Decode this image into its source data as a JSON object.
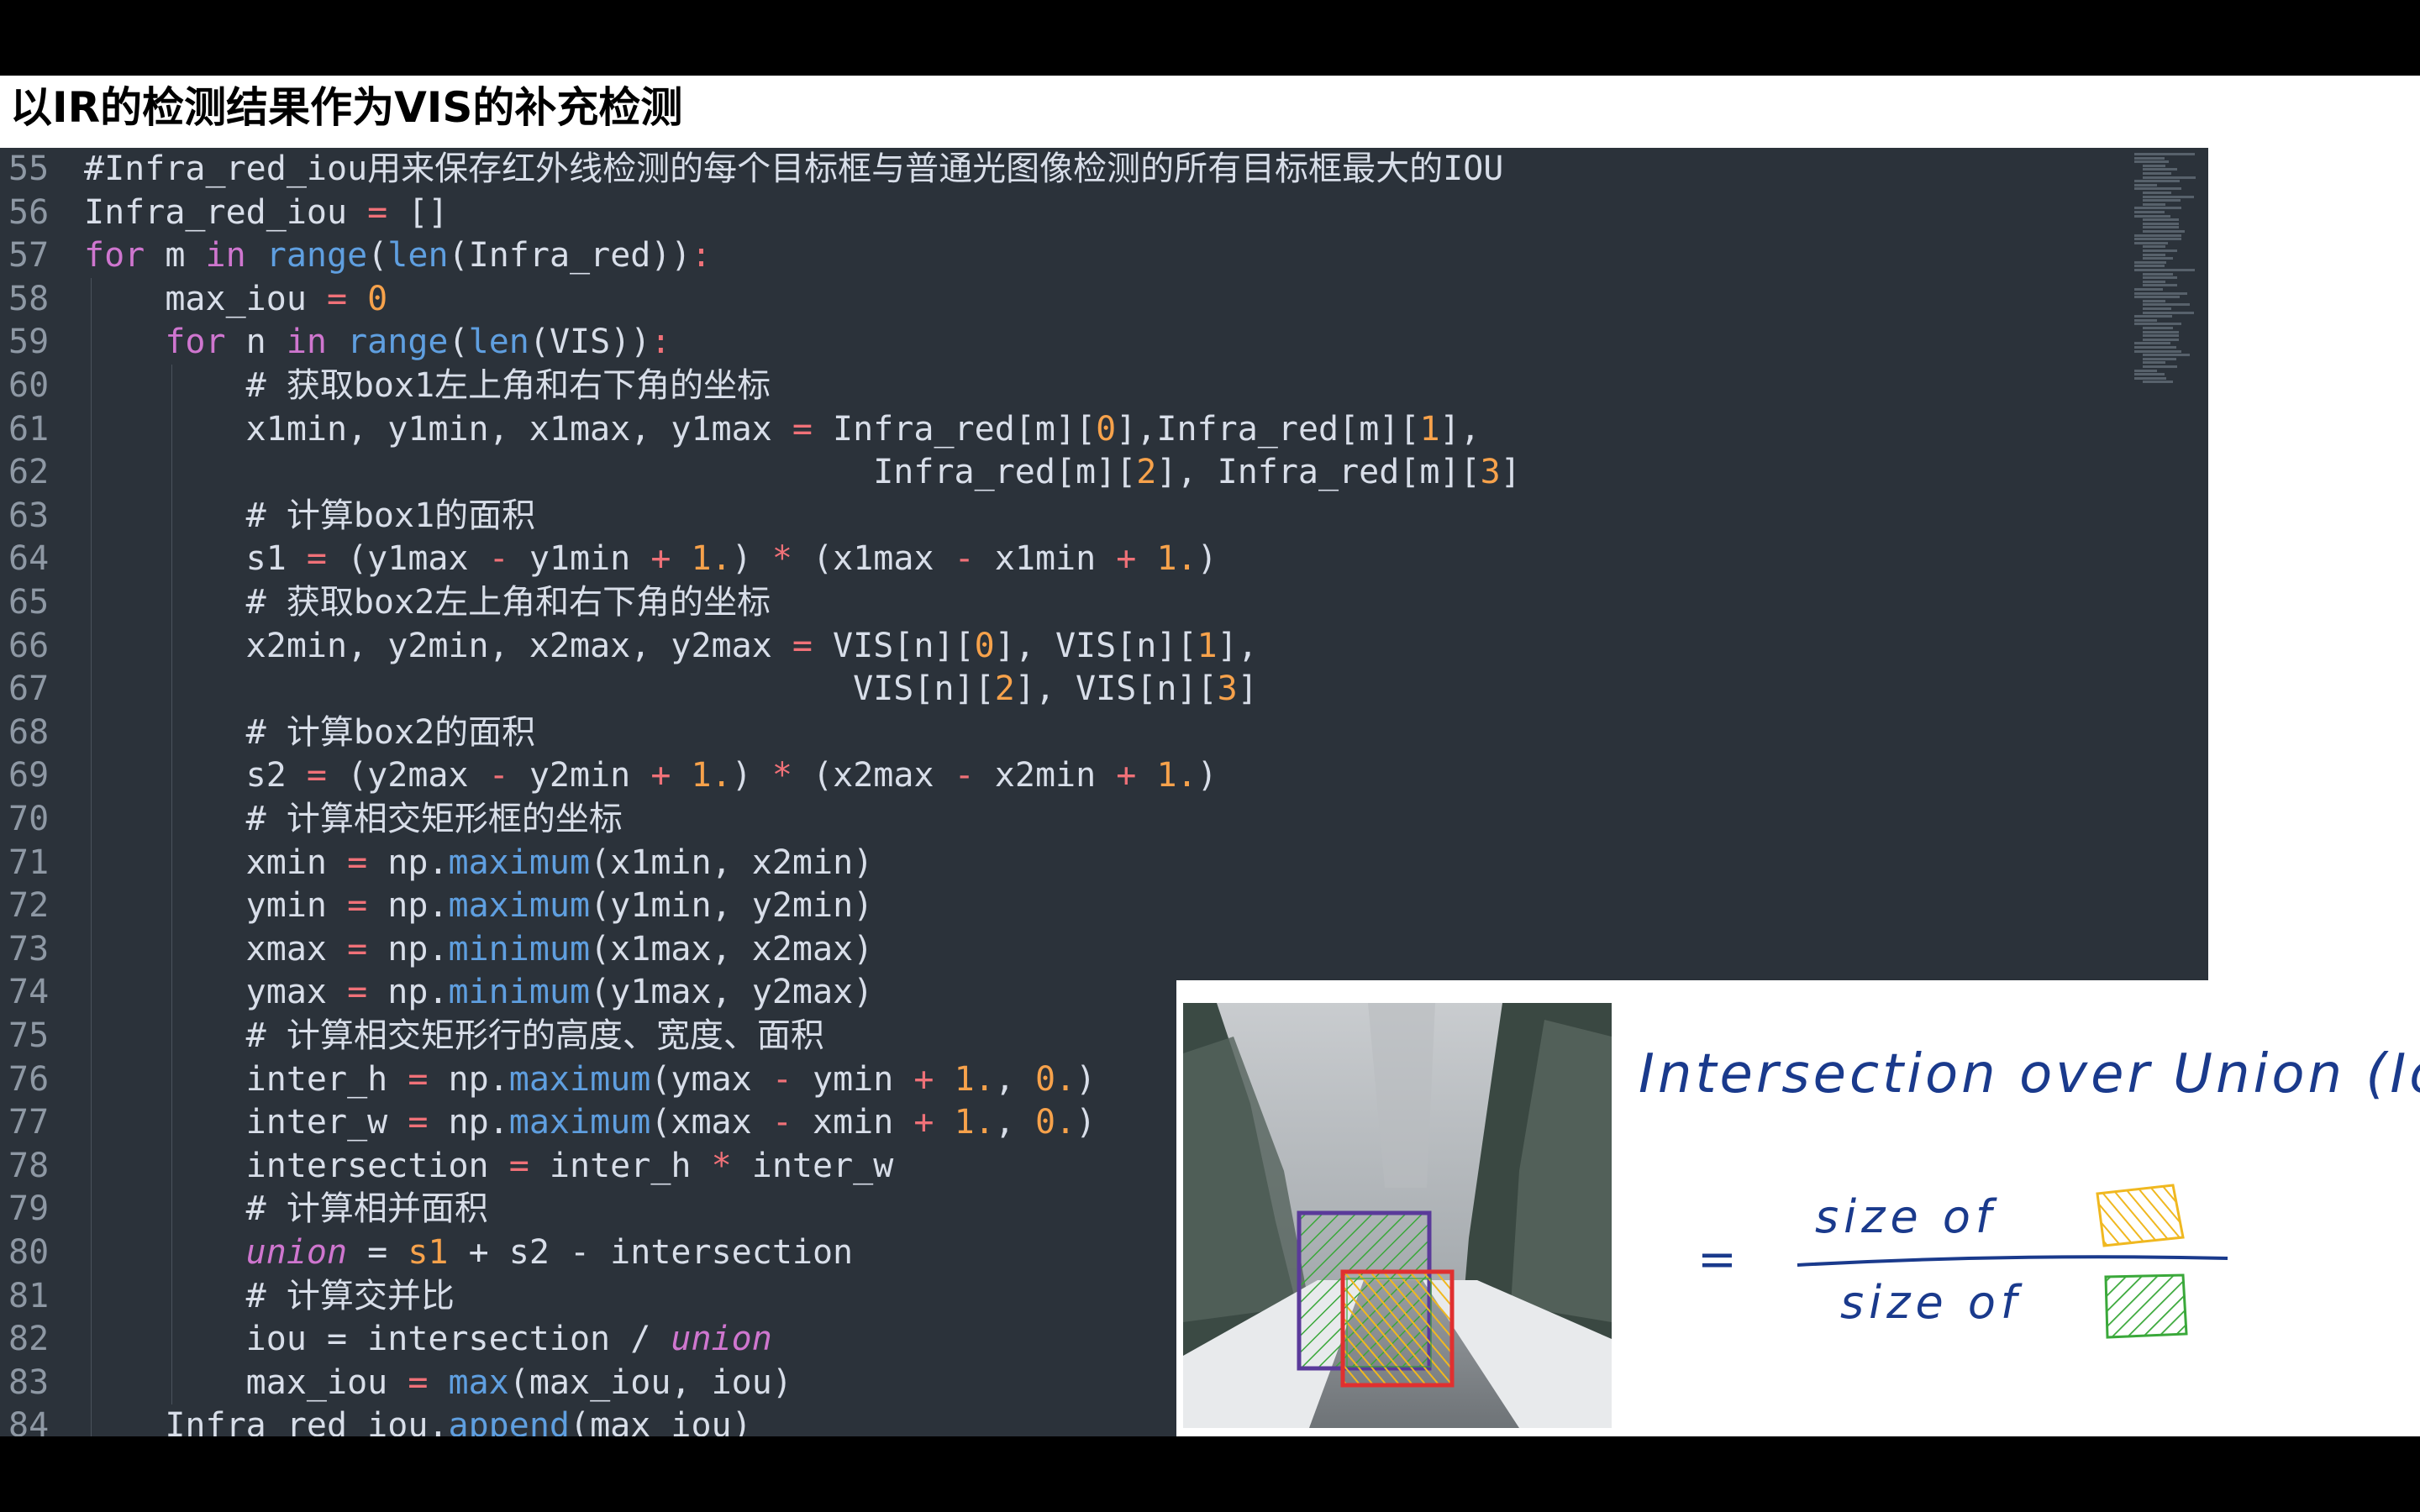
{
  "slide": {
    "title": "以IR的检测结果作为VIS的补充检测"
  },
  "editor": {
    "lines": [
      {
        "n": "55",
        "indent": 0,
        "tokens": [
          [
            "c",
            "#Infra_red_iou用来保存红外线检测的每个目标框与普通光图像检测的所有目标框最大的IOU"
          ]
        ]
      },
      {
        "n": "56",
        "indent": 0,
        "tokens": [
          [
            "p",
            "Infra_red_iou "
          ],
          [
            "o",
            "="
          ],
          [
            "p",
            " []"
          ]
        ]
      },
      {
        "n": "57",
        "indent": 0,
        "tokens": [
          [
            "k",
            "for"
          ],
          [
            "p",
            " m "
          ],
          [
            "k",
            "in"
          ],
          [
            "p",
            " "
          ],
          [
            "f",
            "range"
          ],
          [
            "p",
            "("
          ],
          [
            "f",
            "len"
          ],
          [
            "p",
            "(Infra_red))"
          ],
          [
            "o",
            ":"
          ]
        ]
      },
      {
        "n": "58",
        "indent": 1,
        "tokens": [
          [
            "p",
            "max_iou "
          ],
          [
            "o",
            "="
          ],
          [
            "p",
            " "
          ],
          [
            "n",
            "0"
          ]
        ]
      },
      {
        "n": "59",
        "indent": 1,
        "tokens": [
          [
            "k",
            "for"
          ],
          [
            "p",
            " n "
          ],
          [
            "k",
            "in"
          ],
          [
            "p",
            " "
          ],
          [
            "f",
            "range"
          ],
          [
            "p",
            "("
          ],
          [
            "f",
            "len"
          ],
          [
            "p",
            "(VIS))"
          ],
          [
            "o",
            ":"
          ]
        ]
      },
      {
        "n": "60",
        "indent": 2,
        "tokens": [
          [
            "c",
            "# 获取box1左上角和右下角的坐标"
          ]
        ]
      },
      {
        "n": "61",
        "indent": 2,
        "tokens": [
          [
            "p",
            "x1min, y1min, x1max, y1max "
          ],
          [
            "o",
            "="
          ],
          [
            "p",
            " Infra_red[m]["
          ],
          [
            "n",
            "0"
          ],
          [
            "p",
            "],Infra_red[m]["
          ],
          [
            "n",
            "1"
          ],
          [
            "p",
            "],"
          ]
        ]
      },
      {
        "n": "62",
        "indent": 2,
        "tokens": [
          [
            "p",
            "                               Infra_red[m]["
          ],
          [
            "n",
            "2"
          ],
          [
            "p",
            "], Infra_red[m]["
          ],
          [
            "n",
            "3"
          ],
          [
            "p",
            "]"
          ]
        ]
      },
      {
        "n": "63",
        "indent": 2,
        "tokens": [
          [
            "c",
            "# 计算box1的面积"
          ]
        ]
      },
      {
        "n": "64",
        "indent": 2,
        "tokens": [
          [
            "p",
            "s1 "
          ],
          [
            "o",
            "="
          ],
          [
            "p",
            " (y1max "
          ],
          [
            "o",
            "-"
          ],
          [
            "p",
            " y1min "
          ],
          [
            "o",
            "+"
          ],
          [
            "p",
            " "
          ],
          [
            "n",
            "1."
          ],
          [
            "p",
            ") "
          ],
          [
            "o",
            "*"
          ],
          [
            "p",
            " (x1max "
          ],
          [
            "o",
            "-"
          ],
          [
            "p",
            " x1min "
          ],
          [
            "o",
            "+"
          ],
          [
            "p",
            " "
          ],
          [
            "n",
            "1."
          ],
          [
            "p",
            ")"
          ]
        ]
      },
      {
        "n": "65",
        "indent": 2,
        "tokens": [
          [
            "c",
            "# 获取box2左上角和右下角的坐标"
          ]
        ]
      },
      {
        "n": "66",
        "indent": 2,
        "tokens": [
          [
            "p",
            "x2min, y2min, x2max, y2max "
          ],
          [
            "o",
            "="
          ],
          [
            "p",
            " VIS[n]["
          ],
          [
            "n",
            "0"
          ],
          [
            "p",
            "], VIS[n]["
          ],
          [
            "n",
            "1"
          ],
          [
            "p",
            "],"
          ]
        ]
      },
      {
        "n": "67",
        "indent": 2,
        "tokens": [
          [
            "p",
            "                              VIS[n]["
          ],
          [
            "n",
            "2"
          ],
          [
            "p",
            "], VIS[n]["
          ],
          [
            "n",
            "3"
          ],
          [
            "p",
            "]"
          ]
        ]
      },
      {
        "n": "68",
        "indent": 2,
        "tokens": [
          [
            "c",
            "# 计算box2的面积"
          ]
        ]
      },
      {
        "n": "69",
        "indent": 2,
        "tokens": [
          [
            "p",
            "s2 "
          ],
          [
            "o",
            "="
          ],
          [
            "p",
            " (y2max "
          ],
          [
            "o",
            "-"
          ],
          [
            "p",
            " y2min "
          ],
          [
            "o",
            "+"
          ],
          [
            "p",
            " "
          ],
          [
            "n",
            "1."
          ],
          [
            "p",
            ") "
          ],
          [
            "o",
            "*"
          ],
          [
            "p",
            " (x2max "
          ],
          [
            "o",
            "-"
          ],
          [
            "p",
            " x2min "
          ],
          [
            "o",
            "+"
          ],
          [
            "p",
            " "
          ],
          [
            "n",
            "1."
          ],
          [
            "p",
            ")"
          ]
        ]
      },
      {
        "n": "70",
        "indent": 2,
        "tokens": [
          [
            "c",
            "# 计算相交矩形框的坐标"
          ]
        ]
      },
      {
        "n": "71",
        "indent": 2,
        "tokens": [
          [
            "p",
            "xmin "
          ],
          [
            "o",
            "="
          ],
          [
            "p",
            " np."
          ],
          [
            "f",
            "maximum"
          ],
          [
            "p",
            "(x1min, x2min)"
          ]
        ]
      },
      {
        "n": "72",
        "indent": 2,
        "tokens": [
          [
            "p",
            "ymin "
          ],
          [
            "o",
            "="
          ],
          [
            "p",
            " np."
          ],
          [
            "f",
            "maximum"
          ],
          [
            "p",
            "(y1min, y2min)"
          ]
        ]
      },
      {
        "n": "73",
        "indent": 2,
        "tokens": [
          [
            "p",
            "xmax "
          ],
          [
            "o",
            "="
          ],
          [
            "p",
            " np."
          ],
          [
            "f",
            "minimum"
          ],
          [
            "p",
            "(x1max, x2max)"
          ]
        ]
      },
      {
        "n": "74",
        "indent": 2,
        "tokens": [
          [
            "p",
            "ymax "
          ],
          [
            "o",
            "="
          ],
          [
            "p",
            " np."
          ],
          [
            "f",
            "minimum"
          ],
          [
            "p",
            "(y1max, y2max)"
          ]
        ]
      },
      {
        "n": "75",
        "indent": 2,
        "tokens": [
          [
            "c",
            "# 计算相交矩形行的高度、宽度、面积"
          ]
        ]
      },
      {
        "n": "76",
        "indent": 2,
        "tokens": [
          [
            "p",
            "inter_h "
          ],
          [
            "o",
            "="
          ],
          [
            "p",
            " np."
          ],
          [
            "f",
            "maximum"
          ],
          [
            "p",
            "(ymax "
          ],
          [
            "o",
            "-"
          ],
          [
            "p",
            " ymin "
          ],
          [
            "o",
            "+"
          ],
          [
            "p",
            " "
          ],
          [
            "n",
            "1."
          ],
          [
            "p",
            ", "
          ],
          [
            "n",
            "0."
          ],
          [
            "p",
            ")"
          ]
        ]
      },
      {
        "n": "77",
        "indent": 2,
        "tokens": [
          [
            "p",
            "inter_w "
          ],
          [
            "o",
            "="
          ],
          [
            "p",
            " np."
          ],
          [
            "f",
            "maximum"
          ],
          [
            "p",
            "(xmax "
          ],
          [
            "o",
            "-"
          ],
          [
            "p",
            " xmin "
          ],
          [
            "o",
            "+"
          ],
          [
            "p",
            " "
          ],
          [
            "n",
            "1."
          ],
          [
            "p",
            ", "
          ],
          [
            "n",
            "0."
          ],
          [
            "p",
            ")"
          ]
        ]
      },
      {
        "n": "78",
        "indent": 2,
        "tokens": [
          [
            "p",
            "intersection "
          ],
          [
            "o",
            "="
          ],
          [
            "p",
            " inter_h "
          ],
          [
            "o",
            "*"
          ],
          [
            "p",
            " inter_w"
          ]
        ]
      },
      {
        "n": "79",
        "indent": 2,
        "tokens": [
          [
            "c",
            "# 计算相并面积"
          ]
        ]
      },
      {
        "n": "80",
        "indent": 2,
        "tokens": [
          [
            "i",
            "union"
          ],
          [
            "p",
            " = "
          ],
          [
            "s",
            "s1"
          ],
          [
            "p",
            " + s2 - intersection"
          ]
        ]
      },
      {
        "n": "81",
        "indent": 2,
        "tokens": [
          [
            "c",
            "# 计算交并比"
          ]
        ]
      },
      {
        "n": "82",
        "indent": 2,
        "tokens": [
          [
            "p",
            "iou = intersection / "
          ],
          [
            "i",
            "union"
          ]
        ]
      },
      {
        "n": "83",
        "indent": 2,
        "tokens": [
          [
            "p",
            "max_iou "
          ],
          [
            "o",
            "="
          ],
          [
            "p",
            " "
          ],
          [
            "f",
            "max"
          ],
          [
            "p",
            "(max_iou, iou)"
          ]
        ]
      },
      {
        "n": "84",
        "indent": 1,
        "tokens": [
          [
            "p",
            "Infra_red_iou."
          ],
          [
            "f",
            "append"
          ],
          [
            "p",
            "(max_iou)"
          ]
        ]
      }
    ]
  },
  "figure": {
    "handwriting": {
      "title": "Intersection over Union (IoU)",
      "equals": "=",
      "numerator": "size of",
      "denominator": "size of"
    },
    "colors": {
      "ink": "#1a3a8c",
      "box_purple": "#5a3a9a",
      "box_red": "#e03030",
      "hatch_green": "#3aa83a",
      "hatch_yellow": "#f0b820"
    }
  }
}
